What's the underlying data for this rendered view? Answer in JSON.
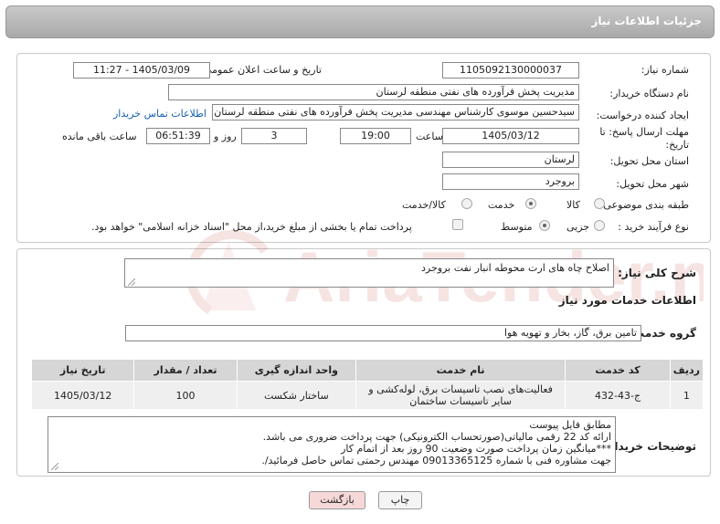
{
  "header": {
    "title": "جزئیات اطلاعات نیاز"
  },
  "form": {
    "need_number_label": "شماره نیاز:",
    "need_number": "1105092130000037",
    "announce_label": "تاریخ و ساعت اعلان عمومی:",
    "announce_value": "1405/03/09 - 11:27",
    "buyer_org_label": "نام دستگاه خریدار:",
    "buyer_org": "مدیریت پخش فرآورده های نفتی منطقه لرستان",
    "creator_label": "ایجاد کننده درخواست:",
    "creator": "سیدحسین موسوی کارشناس مهندسی مدیریت پخش فرآورده های نفتی منطقه لرستان",
    "contact_link": "اطلاعات تماس خریدار",
    "deadline_label": "مهلت ارسال پاسخ: تا تاریخ:",
    "deadline_date": "1405/03/12",
    "time_label": "ساعت",
    "deadline_time": "19:00",
    "days_value": "3",
    "days_label": "روز و",
    "remaining_time": "06:51:39",
    "remaining_label": "ساعت باقی مانده",
    "province_label": "استان محل تحویل:",
    "province": "لرستان",
    "city_label": "شهر محل تحویل:",
    "city": "بروجرد",
    "category_label": "طبقه بندی موضوعی:",
    "category_options": [
      "کالا",
      "خدمت",
      "کالا/خدمت"
    ],
    "category_selected": "خدمت",
    "purchase_type_label": "نوع فرآیند خرید :",
    "purchase_options": [
      "جزیی",
      "متوسط"
    ],
    "purchase_selected": "متوسط",
    "payment_note": "پرداخت تمام یا بخشی از مبلغ خرید،از محل \"اسناد خزانه اسلامی\" خواهد بود."
  },
  "summary": {
    "label": "شرح کلی نیاز:",
    "value": "اصلاح چاه های ارت محوطه انبار نفت بروجرد"
  },
  "services": {
    "section_title": "اطلاعات خدمات مورد نیاز",
    "group_label": "گروه خدمت:",
    "group_value": "تامین برق، گاز، بخار و تهویه هوا",
    "columns": [
      "ردیف",
      "کد خدمت",
      "نام خدمت",
      "واحد اندازه گیری",
      "تعداد / مقدار",
      "تاریخ نیاز"
    ],
    "rows": [
      {
        "row": "1",
        "code": "ج-43-432",
        "name": "فعالیت‌های نصب تاسیسات برق، لوله‌کشی و سایر تاسیسات ساختمان",
        "unit": "ساختار شکست",
        "qty": "100",
        "date": "1405/03/12"
      }
    ]
  },
  "buyer_notes": {
    "label": "توضیحات خریدار:",
    "lines": [
      "مطابق فایل پیوست",
      "ارائه کد 22 رقمی مالیاتی(صورتحساب الکترونیکی) جهت پرداخت ضروری می باشد.",
      "***میانگین زمان پرداخت صورت وضعیت 90 روز بعد از اتمام کار",
      "جهت مشاوره فنی با شماره 09013365125 مهندس رحمتی تماس حاصل فرمائید/."
    ]
  },
  "buttons": {
    "print": "چاپ",
    "back": "بازگشت"
  },
  "watermark": {
    "text": "AriaTender.neT"
  },
  "colors": {
    "link": "#1a5fb4",
    "back_button_bg": "#f6d8d8",
    "print_button_bg": "#f4f4f4",
    "watermark": "#c0392b"
  }
}
